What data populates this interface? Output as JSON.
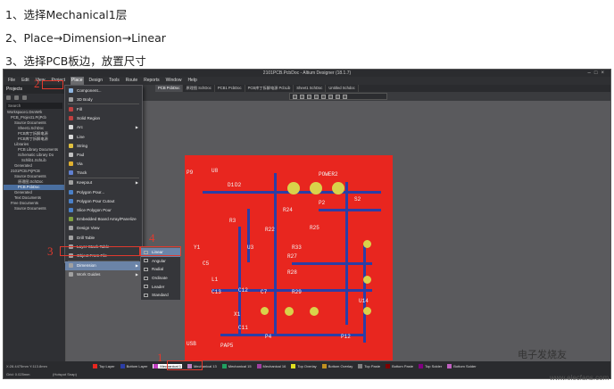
{
  "steps": [
    "1、选择Mechanical1层",
    "2、Place→Dimension→Linear",
    "3、选择PCB板边，放置尺寸"
  ],
  "app": {
    "title": "2101PCB.PcbDoc - Altium Designer (18.1.7)",
    "menubar": [
      "File",
      "Edit",
      "View",
      "Project",
      "Place",
      "Design",
      "Tools",
      "Route",
      "Reports",
      "Window",
      "Help"
    ],
    "active_menu": "Place",
    "doc_tabs": [
      "PCB PcbDoc",
      "原理图 SchDoc",
      "PCB1 PcbDoc",
      "PCB库丁拆解电源 PcbLib",
      "Sheet1 SchDoc",
      "Untitled Schdoc"
    ]
  },
  "projects_panel": {
    "title": "Projects",
    "search": "Search",
    "tree": [
      "Workspace1.DsnWrk",
      "PCB_Project1.PrjPcb",
      "Source Documents",
      "Sheet1.SchDoc",
      "PCB库丁拆解电源",
      "PCB库丁拆解电源",
      "Libraries",
      "PCB Library Documents",
      "Schematic Library Do",
      "Schlib1.SchLib",
      "Generated",
      "2101PCB.PrjPCB",
      "Source Documents",
      "原理图.SchDoc",
      "PCB.PcbDoc",
      "Generated",
      "Text Documents",
      "Free Documents",
      "Source Documents"
    ],
    "selected_index": 14
  },
  "place_menu": {
    "items": [
      {
        "label": "Component...",
        "icon_color": "#8fb6e0"
      },
      {
        "label": "3D Body",
        "icon_color": "#a0a0a0"
      },
      {
        "sep": true
      },
      {
        "label": "Fill",
        "icon_color": "#c04040"
      },
      {
        "label": "Solid Region",
        "icon_color": "#c04040"
      },
      {
        "label": "Arc",
        "icon_color": "#d8d8d8",
        "submenu": true
      },
      {
        "label": "Line",
        "icon_color": "#d8d8d8"
      },
      {
        "label": "String",
        "icon_color": "#e0c040"
      },
      {
        "label": "Pad",
        "icon_color": "#c0c0c0"
      },
      {
        "label": "Via",
        "icon_color": "#e0b030"
      },
      {
        "label": "Track",
        "icon_color": "#6080d0"
      },
      {
        "sep": true
      },
      {
        "label": "Keepout",
        "icon_color": "#a0a0a0",
        "submenu": true
      },
      {
        "label": "Polygon Pour...",
        "icon_color": "#4a80c8"
      },
      {
        "label": "Polygon Pour Cutout",
        "icon_color": "#4a80c8"
      },
      {
        "label": "Slice Polygon Pour",
        "icon_color": "#4a80c8"
      },
      {
        "label": "Embedded Board Array/Panelize",
        "icon_color": "#80a040"
      },
      {
        "label": "Design View",
        "icon_color": "#a0a0a0"
      },
      {
        "label": "Drill Table",
        "icon_color": "#a0a0a0"
      },
      {
        "label": "Layer Stack Table",
        "icon_color": "#a0a0a0"
      },
      {
        "label": "Object From File",
        "icon_color": "#a0a0a0"
      },
      {
        "sep": true
      },
      {
        "label": "Dimension",
        "icon_color": "#a0a0a0",
        "submenu": true,
        "highlight": true
      },
      {
        "label": "Work Guides",
        "icon_color": "#a0a0a0",
        "submenu": true
      }
    ]
  },
  "dimension_submenu": [
    "Linear",
    "Angular",
    "Radial",
    "Ordinate",
    "Leader",
    "Standard"
  ],
  "annotations": [
    "1",
    "2",
    "3",
    "4"
  ],
  "pcb_labels": [
    "P9",
    "U8",
    "D1",
    "D2",
    "POWER2",
    "P2",
    "S2",
    "R3",
    "R24",
    "R25",
    "U3",
    "R22",
    "R33",
    "R27",
    "R28",
    "R29",
    "C7",
    "L1",
    "C13",
    "C12",
    "Y1",
    "X1",
    "U14",
    "P12",
    "USB",
    "PAP5",
    "P4",
    "C5",
    "C11"
  ],
  "layers": [
    {
      "name": "Top Layer",
      "color": "#e8261f"
    },
    {
      "name": "Bottom Layer",
      "color": "#2b3ea6"
    },
    {
      "name": "Mechanical 1",
      "color": "#c040c0",
      "selected": true
    },
    {
      "name": "Mechanical 13",
      "color": "#c080c0"
    },
    {
      "name": "Mechanical 15",
      "color": "#20a060"
    },
    {
      "name": "Mechanical 16",
      "color": "#a040a0"
    },
    {
      "name": "Top Overlay",
      "color": "#e0e020"
    },
    {
      "name": "Bottom Overlay",
      "color": "#c09020"
    },
    {
      "name": "Top Paste",
      "color": "#808080"
    },
    {
      "name": "Bottom Paste",
      "color": "#800000"
    },
    {
      "name": "Top Solder",
      "color": "#800080"
    },
    {
      "name": "Bottom Solder",
      "color": "#c060c0"
    }
  ],
  "status": {
    "coords": "X:28.4475mm Y:113.8mm",
    "grid": "Grid: 0.025mm",
    "snap": "(Hotspot Snap)"
  },
  "watermark": {
    "brand": "电子发烧友",
    "site": "www.elecfans.com"
  }
}
